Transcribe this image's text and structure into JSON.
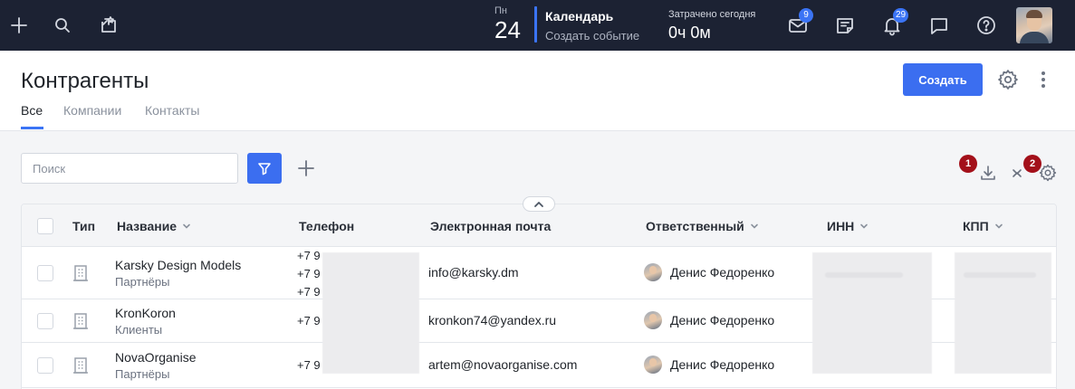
{
  "topbar": {
    "left_icons": [
      "plus-icon",
      "search-icon",
      "new-task-icon"
    ],
    "date": {
      "weekday": "Пн",
      "day": "24"
    },
    "calendar": {
      "title": "Календарь",
      "action": "Создать событие"
    },
    "time_spent": {
      "label": "Затрачено сегодня",
      "value": "0ч 0м"
    },
    "mail_badge": "9",
    "notifications_badge": "29",
    "right_icons": [
      "mail-icon",
      "notes-icon",
      "bell-icon",
      "chat-icon",
      "help-icon"
    ]
  },
  "header": {
    "title": "Контрагенты",
    "tabs": [
      {
        "label": "Все",
        "active": true
      },
      {
        "label": "Компании",
        "active": false
      },
      {
        "label": "Контакты",
        "active": false
      }
    ],
    "create_label": "Создать"
  },
  "toolbar": {
    "search_placeholder": "Поиск",
    "markers": [
      "1",
      "2"
    ]
  },
  "table": {
    "columns": [
      {
        "label": "Тип",
        "sortable": false
      },
      {
        "label": "Название",
        "sortable": true
      },
      {
        "label": "Телефон",
        "sortable": false
      },
      {
        "label": "Электронная почта",
        "sortable": false
      },
      {
        "label": "Ответственный",
        "sortable": true
      },
      {
        "label": "ИНН",
        "sortable": true
      },
      {
        "label": "КПП",
        "sortable": true
      }
    ],
    "rows": [
      {
        "name": "Karsky Design Models",
        "category": "Партнёры",
        "phones": [
          "+7 9",
          "+7 9",
          "+7 9"
        ],
        "email": "info@karsky.dm",
        "responsible": "Денис Федоренко"
      },
      {
        "name": "KronKoron",
        "category": "Клиенты",
        "phones": [
          "+7 9"
        ],
        "email": "kronkon74@yandex.ru",
        "responsible": "Денис Федоренко"
      },
      {
        "name": "NovaOrganise",
        "category": "Партнёры",
        "phones": [
          "+7 9"
        ],
        "email": "artem@novaorganise.com",
        "responsible": "Денис Федоренко"
      }
    ]
  },
  "colors": {
    "topbar_bg": "#1c2233",
    "accent": "#3b6ef0",
    "marker": "#a3101a"
  }
}
